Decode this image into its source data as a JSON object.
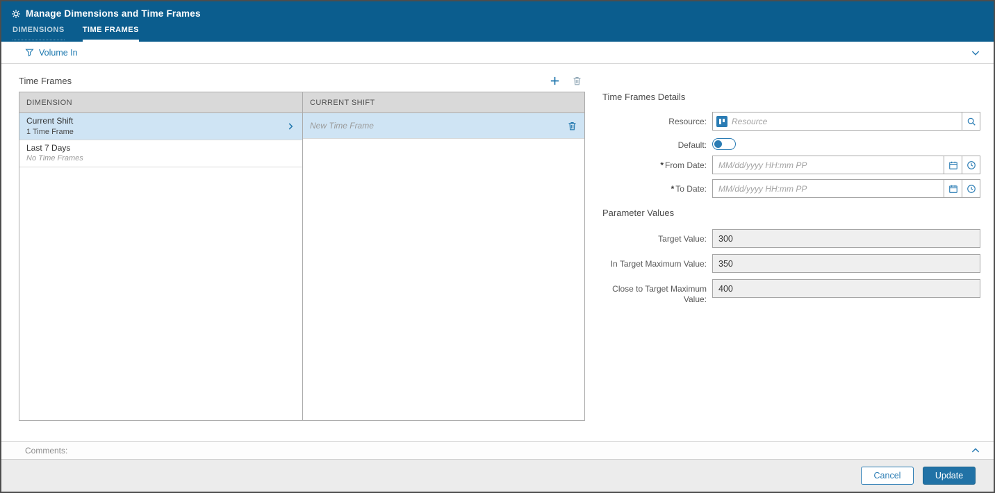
{
  "header": {
    "title": "Manage Dimensions and Time Frames",
    "tabs": [
      {
        "label": "DIMENSIONS",
        "active": false
      },
      {
        "label": "TIME FRAMES",
        "active": true
      }
    ]
  },
  "filter_bar": {
    "label": "Volume In"
  },
  "time_frames": {
    "title": "Time Frames",
    "columns": [
      "DIMENSION",
      "CURRENT SHIFT"
    ],
    "rows": [
      {
        "name": "Current Shift",
        "subtitle": "1 Time Frame",
        "selected": true
      },
      {
        "name": "Last 7 Days",
        "subtitle": "No Time Frames",
        "selected": false
      }
    ],
    "frames": [
      {
        "label": "New Time Frame",
        "selected": true
      }
    ]
  },
  "details": {
    "title": "Time Frames Details",
    "resource": {
      "label": "Resource:",
      "placeholder": "Resource"
    },
    "default_field": {
      "label": "Default:",
      "on": false
    },
    "from_date": {
      "required": "*",
      "label": "From Date:",
      "placeholder": "MM/dd/yyyy HH:mm PP"
    },
    "to_date": {
      "required": "*",
      "label": "To Date:",
      "placeholder": "MM/dd/yyyy HH:mm PP"
    }
  },
  "parameters": {
    "title": "Parameter Values",
    "fields": [
      {
        "label": "Target Value:",
        "value": "300"
      },
      {
        "label": "In Target Maximum Value:",
        "value": "350"
      },
      {
        "label": "Close to Target Maximum Value:",
        "value": "400"
      }
    ]
  },
  "comments": {
    "label": "Comments:"
  },
  "footer": {
    "cancel_label": "Cancel",
    "update_label": "Update"
  },
  "icons": {
    "title": "gear-icon",
    "filter": "funnel-icon",
    "panel_collapse": "chevron-down-icon",
    "add": "plus-icon",
    "delete": "trash-icon",
    "row_expand": "chevron-right-icon",
    "search": "magnifier-icon",
    "calendar": "calendar-icon",
    "clock": "clock-icon",
    "comments_collapse": "chevron-up-icon"
  },
  "colors": {
    "header_bg": "#0b5d8e",
    "accent_blue": "#2178ad",
    "selected_row_bg": "#cfe4f4",
    "table_header_bg": "#d9d9d9",
    "footer_bg": "#ececec"
  }
}
